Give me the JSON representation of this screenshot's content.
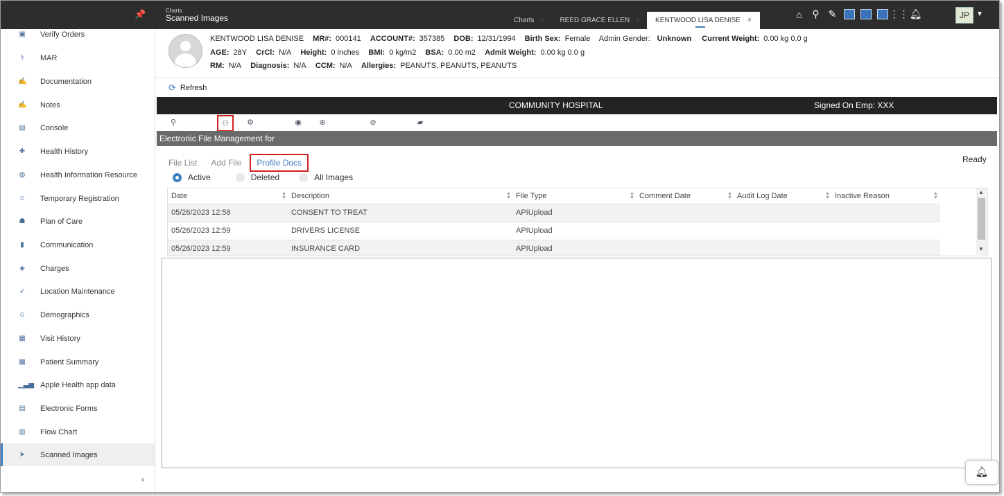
{
  "topbar": {
    "breadcrumb_small": "Charts",
    "breadcrumb_title": "Scanned Images",
    "tabs": [
      {
        "label": "Charts"
      },
      {
        "label": "REED GRACE ELLEN"
      },
      {
        "label": "KENTWOOD LISA DENISE"
      }
    ],
    "close_glyph": "×",
    "user_initials": "JP"
  },
  "sidebar": {
    "items": [
      {
        "label": "Verify Orders",
        "icon": "verify-orders-icon"
      },
      {
        "label": "MAR",
        "icon": "mar-icon"
      },
      {
        "label": "Documentation",
        "icon": "documentation-icon"
      },
      {
        "label": "Notes",
        "icon": "notes-icon"
      },
      {
        "label": "Console",
        "icon": "console-icon"
      },
      {
        "label": "Health History",
        "icon": "health-history-icon"
      },
      {
        "label": "Health Information Resource",
        "icon": "globe-icon"
      },
      {
        "label": "Temporary Registration",
        "icon": "person-icon"
      },
      {
        "label": "Plan of Care",
        "icon": "plan-icon"
      },
      {
        "label": "Communication",
        "icon": "phone-icon"
      },
      {
        "label": "Charges",
        "icon": "charges-icon"
      },
      {
        "label": "Location Maintenance",
        "icon": "location-icon"
      },
      {
        "label": "Demographics",
        "icon": "person-icon"
      },
      {
        "label": "Visit History",
        "icon": "visit-history-icon"
      },
      {
        "label": "Patient Summary",
        "icon": "summary-icon"
      },
      {
        "label": "Apple Health app data",
        "icon": "bar-chart-icon"
      },
      {
        "label": "Electronic Forms",
        "icon": "forms-icon"
      },
      {
        "label": "Flow Chart",
        "icon": "flow-chart-icon"
      },
      {
        "label": "Scanned Images",
        "icon": "scanned-images-icon"
      }
    ]
  },
  "patient": {
    "name": "KENTWOOD LISA DENISE",
    "mr_label": "MR#:",
    "mr": "000141",
    "account_label": "ACCOUNT#:",
    "account": "357385",
    "dob_label": "DOB:",
    "dob": "12/31/1994",
    "birth_sex_label": "Birth Sex:",
    "birth_sex": "Female",
    "admin_gender_label": "Admin Gender:",
    "admin_gender": "Unknown",
    "current_weight_label": "Current Weight:",
    "current_weight": "0.00 kg 0.0 g",
    "age_label": "AGE:",
    "age": "28Y",
    "crcl_label": "CrCl:",
    "crcl": "N/A",
    "height_label": "Height:",
    "height": "0 inches",
    "bmi_label": "BMI:",
    "bmi": "0 kg/m2",
    "bsa_label": "BSA:",
    "bsa": "0.00 m2",
    "admit_weight_label": "Admit Weight:",
    "admit_weight": "0.00 kg 0.0 g",
    "rm_label": "RM:",
    "rm": "N/A",
    "diagnosis_label": "Diagnosis:",
    "diagnosis": "N/A",
    "ccm_label": "CCM:",
    "ccm": "N/A",
    "allergies_label": "Allergies:",
    "allergies": "PEANUTS, PEANUTS, PEANUTS"
  },
  "refresh_label": "Refresh",
  "hospital": {
    "name": "COMMUNITY HOSPITAL",
    "signed_on": "Signed On Emp: XXX"
  },
  "efm_title": "Electronic File Management for",
  "subtabs": [
    {
      "label": "File List"
    },
    {
      "label": "Add File"
    },
    {
      "label": "Profile Docs"
    }
  ],
  "status": "Ready",
  "filters": [
    {
      "label": "Active"
    },
    {
      "label": "Deleted"
    },
    {
      "label": "All Images"
    }
  ],
  "table": {
    "columns": [
      "Date",
      "Description",
      "File Type",
      "Comment Date",
      "Audit Log Date",
      "Inactive Reason"
    ],
    "rows": [
      {
        "date": "05/26/2023 12:58",
        "description": "CONSENT TO TREAT",
        "file_type": "APIUpload"
      },
      {
        "date": "05/26/2023 12:59",
        "description": "DRIVERS LICENSE",
        "file_type": "APIUpload"
      },
      {
        "date": "05/26/2023 12:59",
        "description": "INSURANCE CARD",
        "file_type": "APIUpload"
      }
    ]
  },
  "colors": {
    "accent": "#3c7fc1",
    "highlight": "#d21f1f",
    "topbar": "#2d2d2d"
  }
}
